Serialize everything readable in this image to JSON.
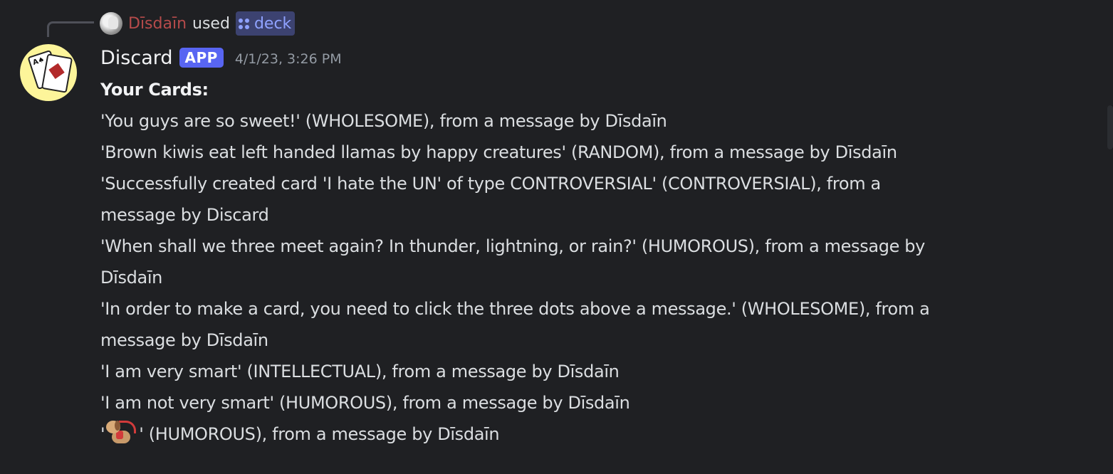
{
  "interaction": {
    "user": "Dīsdaīn",
    "used_text": "used",
    "command": "deck",
    "user_color": "#b64b4b",
    "command_color": "#8fa2ff",
    "command_icon": "slash-command-grid-icon"
  },
  "message": {
    "author": "Discard",
    "badge": "APP",
    "timestamp": "4/1/23, 3:26 PM",
    "avatar_icon": "playing-cards-icon",
    "heading": "Your Cards:",
    "lines": [
      "'You guys are so sweet!' (WHOLESOME), from a message by Dīsdaīn",
      "'Brown kiwis eat left handed llamas by happy creatures' (RANDOM), from a message by Dīsdaīn",
      "'Successfully created card 'I hate the UN' of type CONTROVERSIAL' (CONTROVERSIAL), from a",
      "message by Discard",
      "'When shall we three meet again? In thunder, lightning, or rain?' (HUMOROUS), from a message by",
      "Dīsdaīn",
      "'In order to make a card, you need to click the three dots above a message.' (WHOLESOME), from a",
      "message by Dīsdaīn",
      "'I am very smart' (INTELLECTUAL), from a message by Dīsdaīn",
      "'I am not very smart' (HUMOROUS), from a message by Dīsdaīn"
    ],
    "last_line": {
      "prefix": "'",
      "emoji": "service-dog-emoji",
      "suffix": "' (HUMOROUS), from a message by Dīsdaīn"
    }
  },
  "colors": {
    "background": "#1f2023",
    "text": "#dbdee1",
    "badge": "#5865f2",
    "avatar_bg": "#fdf59a"
  }
}
